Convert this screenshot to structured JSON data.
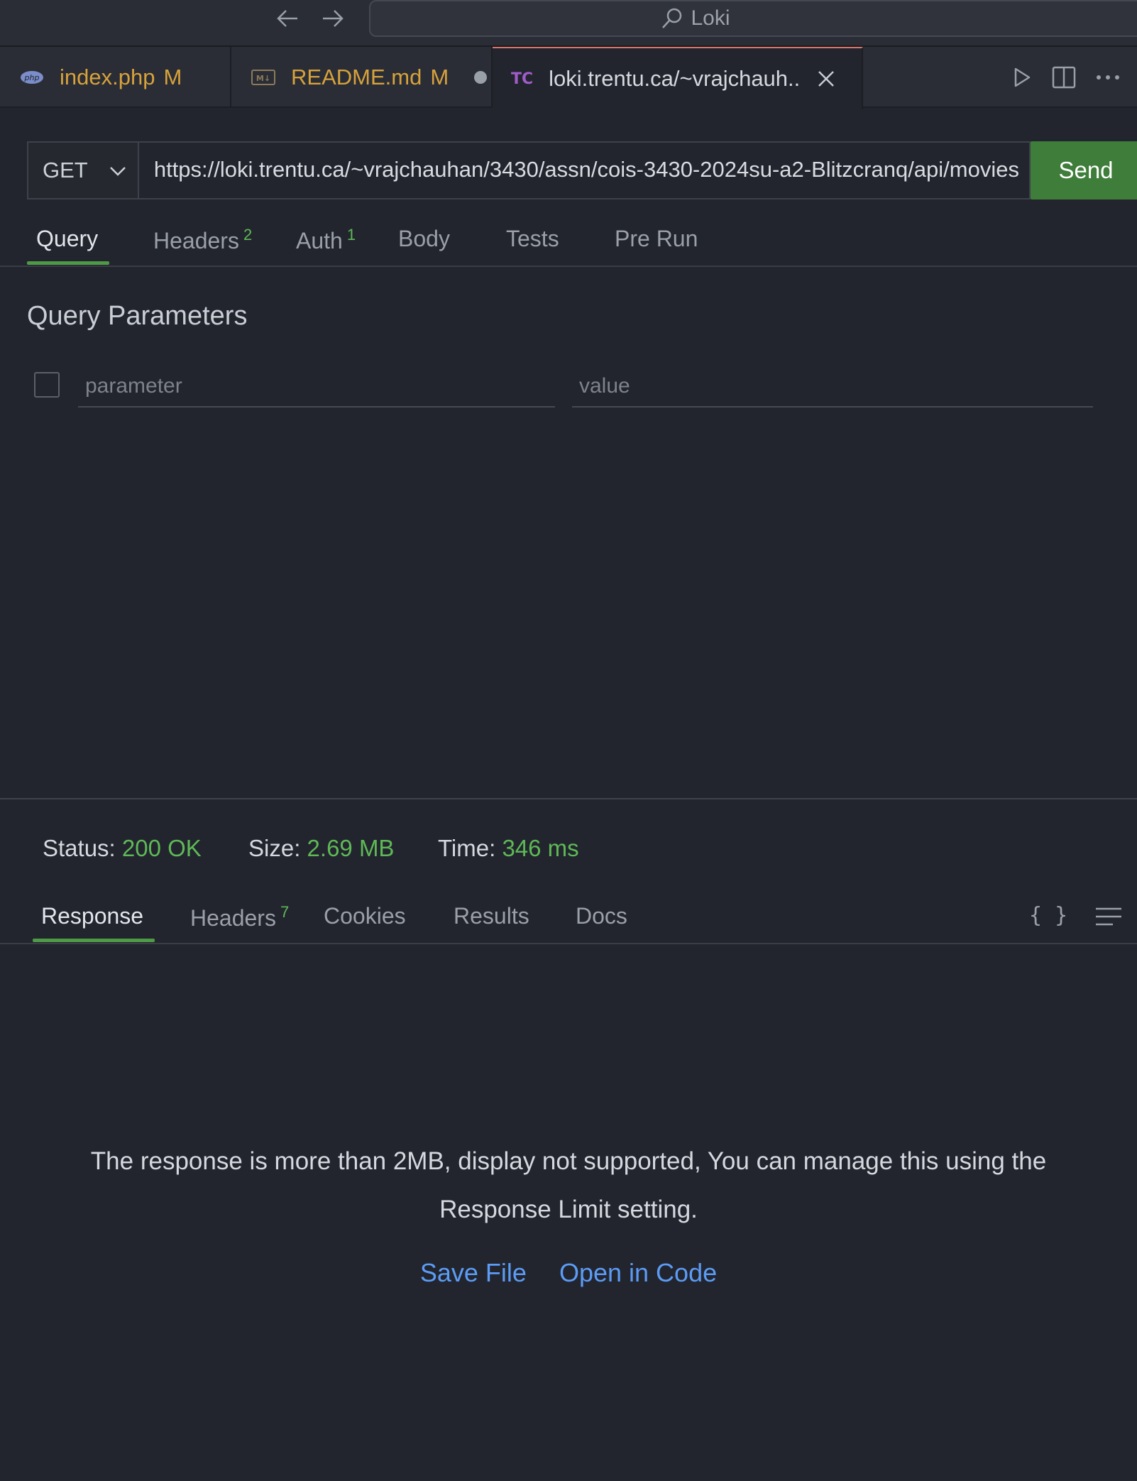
{
  "titlebar": {
    "search_text": "Loki"
  },
  "tabs": [
    {
      "label": "index.php",
      "badge": "M",
      "icon": "php-icon"
    },
    {
      "label": "README.md",
      "badge": "M",
      "icon": "markdown-icon"
    },
    {
      "label": "loki.trentu.ca/~vrajchauh..",
      "icon_text": "TC"
    }
  ],
  "request": {
    "method": "GET",
    "url": "https://loki.trentu.ca/~vrajchauhan/3430/assn/cois-3430-2024su-a2-Blitzcranq/api/movies",
    "send_label": "Send",
    "tabs": {
      "query": "Query",
      "headers": "Headers",
      "headers_count": "2",
      "auth": "Auth",
      "auth_count": "1",
      "body": "Body",
      "tests": "Tests",
      "prerun": "Pre Run"
    },
    "query_title": "Query Parameters",
    "param_placeholder": "parameter",
    "value_placeholder": "value"
  },
  "response": {
    "status_label": "Status:",
    "status_value": "200 OK",
    "size_label": "Size:",
    "size_value": "2.69 MB",
    "time_label": "Time:",
    "time_value": "346 ms",
    "tabs": {
      "response": "Response",
      "headers": "Headers",
      "headers_count": "7",
      "cookies": "Cookies",
      "results": "Results",
      "docs": "Docs"
    },
    "format_icon_text": "{ }",
    "message": "The response is more than 2MB, display not supported, You can manage this using the Response Limit setting.",
    "save_file": "Save File",
    "open_in_code": "Open in Code"
  },
  "colors": {
    "accent_green": "#4e9a46",
    "link_blue": "#5c9cf5",
    "modified_orange": "#d7a23c"
  }
}
